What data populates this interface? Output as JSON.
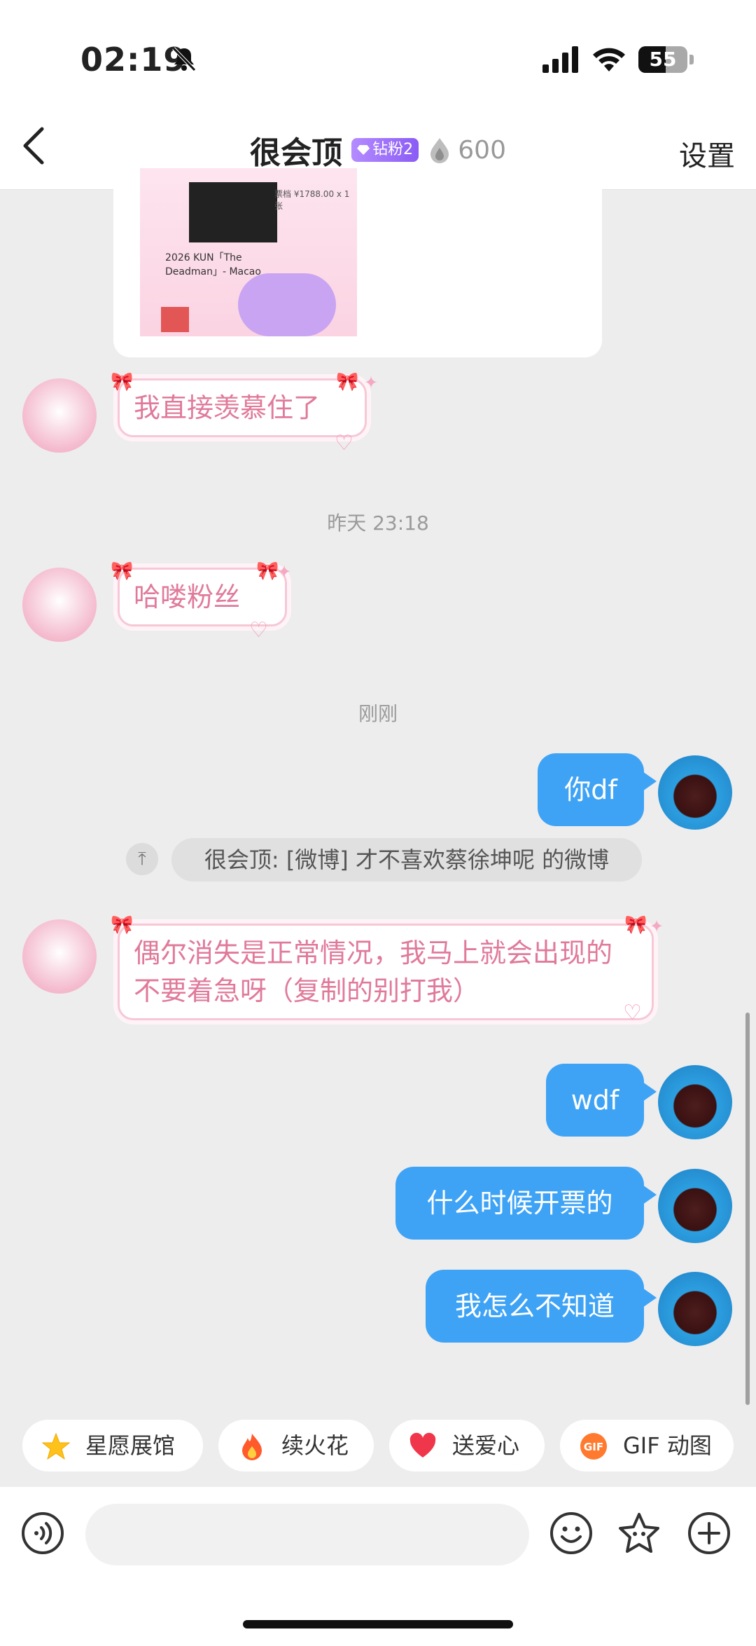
{
  "status_bar": {
    "time": "02:19",
    "battery_level": "55",
    "battery_fraction": 0.55
  },
  "header": {
    "title": "很会顶",
    "badge": "钻粉2",
    "fire_count": "600",
    "settings_label": "设置"
  },
  "shared_card": {
    "ticket_info": "票档 ¥1788.00 x 1张",
    "event_text": "2026 KUN「The Deadman」- Macao"
  },
  "messages": [
    {
      "side": "left",
      "text": "我直接羡慕住了"
    },
    {
      "side": "timestamp",
      "text": "昨天 23:18"
    },
    {
      "side": "left",
      "text": "哈喽粉丝"
    },
    {
      "side": "timestamp",
      "text": "刚刚"
    },
    {
      "side": "right",
      "text": "你df"
    },
    {
      "side": "share",
      "text": "很会顶: [微博] 才不喜欢蔡徐坤呢 的微博"
    },
    {
      "side": "left",
      "text": "偶尔消失是正常情况，我马上就会出现的不要着急呀（复制的别打我）"
    },
    {
      "side": "right",
      "text": "wdf"
    },
    {
      "side": "right",
      "text": "什么时候开票的"
    },
    {
      "side": "right",
      "text": "我怎么不知道"
    }
  ],
  "quick_actions": [
    {
      "label": "星愿展馆",
      "icon": "star-icon"
    },
    {
      "label": "续火花",
      "icon": "fire-icon"
    },
    {
      "label": "送爱心",
      "icon": "heart-icon"
    },
    {
      "label": "GIF 动图",
      "icon": "gif-icon"
    }
  ],
  "input_bar": {
    "placeholder": ""
  },
  "colors": {
    "accent_blue": "#3fa3f5",
    "pink_text": "#e07a9a",
    "background": "#ededed"
  }
}
